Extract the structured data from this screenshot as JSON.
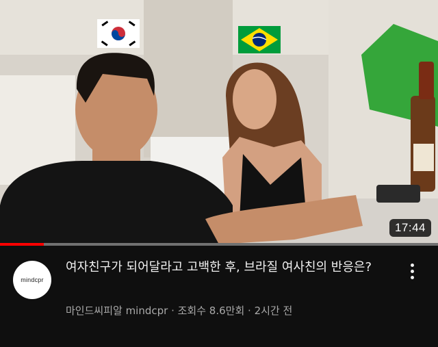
{
  "video": {
    "duration": "17:44",
    "watch_progress": 0.1
  },
  "channel": {
    "avatar_text": "mindcpr",
    "name": "마인드씨피알 mindcpr"
  },
  "title": "여자친구가 되어달라고 고백한 후, 브라질 여사친의 반응은?",
  "subline": {
    "separator": " · ",
    "views": "조회수 8.6만회",
    "age": "2시간 전"
  },
  "icons": {
    "more": "more-vert-icon",
    "flag_left": "south-korea-flag-icon",
    "flag_right": "brazil-flag-icon"
  }
}
